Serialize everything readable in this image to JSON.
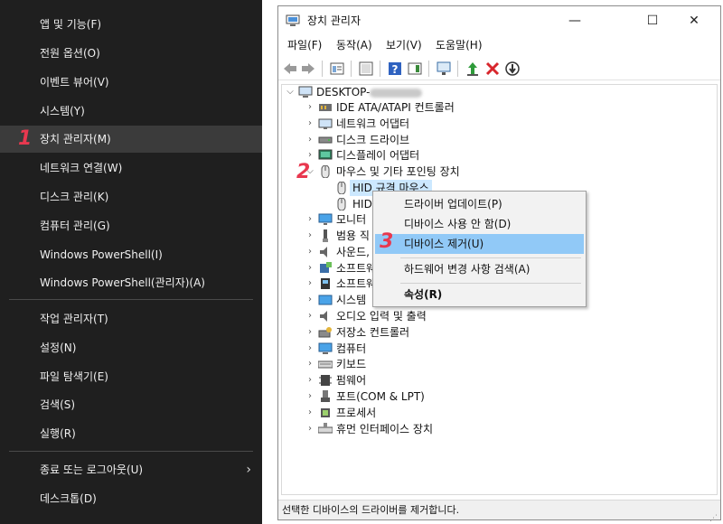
{
  "winx_menu": {
    "items": [
      {
        "label": "앱 및 기능(F)"
      },
      {
        "label": "전원 옵션(O)"
      },
      {
        "label": "이벤트 뷰어(V)"
      },
      {
        "label": "시스템(Y)"
      },
      {
        "label": "장치 관리자(M)"
      },
      {
        "label": "네트워크 연결(W)"
      },
      {
        "label": "디스크 관리(K)"
      },
      {
        "label": "컴퓨터 관리(G)"
      },
      {
        "label": "Windows PowerShell(I)"
      },
      {
        "label": "Windows PowerShell(관리자)(A)"
      },
      {
        "label": "작업 관리자(T)"
      },
      {
        "label": "설정(N)"
      },
      {
        "label": "파일 탐색기(E)"
      },
      {
        "label": "검색(S)"
      },
      {
        "label": "실행(R)"
      },
      {
        "label": "종료 또는 로그아웃(U)"
      },
      {
        "label": "데스크톱(D)"
      }
    ],
    "submenu_arrow": "›"
  },
  "steps": {
    "one": "1",
    "two": "2",
    "three": "3"
  },
  "device_manager": {
    "title": "장치 관리자",
    "window_buttons": {
      "minimize": "—",
      "maximize": "☐",
      "close": "✕"
    },
    "menus": [
      "파일(F)",
      "동작(A)",
      "보기(V)",
      "도움말(H)"
    ],
    "tree": {
      "root": "DESKTOP-",
      "categories": [
        {
          "label": "IDE ATA/ATAPI 컨트롤러"
        },
        {
          "label": "네트워크 어댑터"
        },
        {
          "label": "디스크 드라이브"
        },
        {
          "label": "디스플레이 어댑터"
        },
        {
          "label": "마우스 및 기타 포인팅 장치"
        },
        {
          "label": "HID 규격 마우스"
        },
        {
          "label": "HID"
        },
        {
          "label": "모니터"
        },
        {
          "label": "범용 직"
        },
        {
          "label": "사운드,"
        },
        {
          "label": "소프트웨"
        },
        {
          "label": "소프트웨"
        },
        {
          "label": "시스템"
        },
        {
          "label": "오디오 입력 및 출력"
        },
        {
          "label": "저장소 컨트롤러"
        },
        {
          "label": "컴퓨터"
        },
        {
          "label": "키보드"
        },
        {
          "label": "펌웨어"
        },
        {
          "label": "포트(COM & LPT)"
        },
        {
          "label": "프로세서"
        },
        {
          "label": "휴먼 인터페이스 장치"
        }
      ]
    },
    "status_text": "선택한 디바이스의 드라이버를 제거합니다."
  },
  "context_menu": {
    "items": [
      {
        "label": "드라이버 업데이트(P)"
      },
      {
        "label": "디바이스 사용 안 함(D)"
      },
      {
        "label": "디바이스 제거(U)"
      },
      {
        "label": "하드웨어 변경 사항 검색(A)"
      },
      {
        "label": "속성(R)"
      }
    ]
  },
  "colors": {
    "menu_bg": "#1f1f1f",
    "menu_highlight": "#3b3b3b",
    "step_badge": "#e8384f",
    "ctx_highlight": "#91c9f7",
    "tree_selection": "#cce8ff"
  }
}
